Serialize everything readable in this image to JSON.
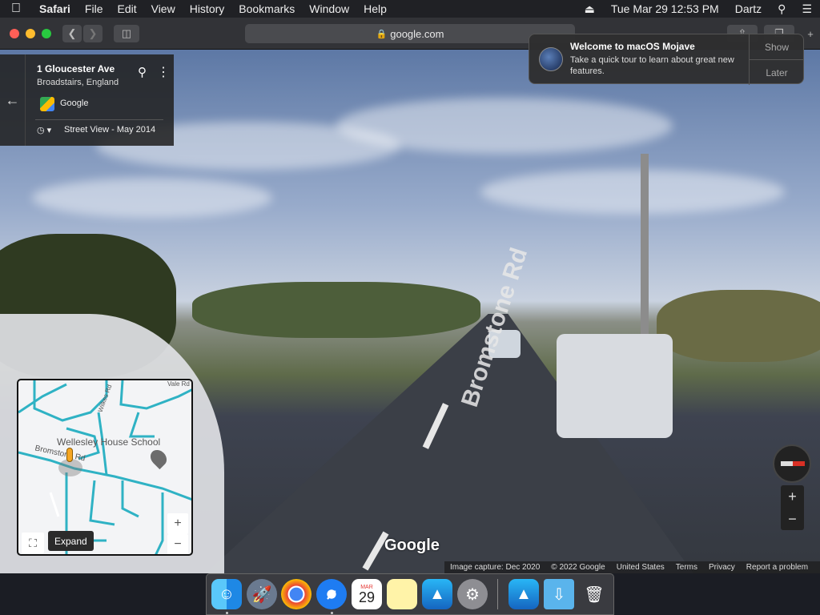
{
  "menubar": {
    "apple": "",
    "app": "Safari",
    "menus": [
      "File",
      "Edit",
      "View",
      "History",
      "Bookmarks",
      "Window",
      "Help"
    ],
    "datetime": "Tue Mar 29  12:53 PM",
    "user": "Dartz"
  },
  "toolbar": {
    "url": "google.com"
  },
  "infocard": {
    "title": "1 Gloucester Ave",
    "subtitle": "Broadstairs, England",
    "brand": "Google",
    "history": "Street View - May 2014"
  },
  "notification": {
    "title": "Welcome to macOS Mojave",
    "body": "Take a quick tour to learn about great new features.",
    "show_label": "Show",
    "later_label": "Later"
  },
  "road_label": "Bromstone Rd",
  "minimap": {
    "labels": {
      "school": "Wellesley House School",
      "road": "Bromstone Rd",
      "street": "Wilkes Rd",
      "vale": "Vale Rd"
    },
    "expand_tooltip": "Expand",
    "zoom_in": "+",
    "zoom_out": "−"
  },
  "zoom": {
    "in": "+",
    "out": "−"
  },
  "google_logo": "Google",
  "footer": {
    "capture": "Image capture: Dec 2020",
    "copyright": "© 2022 Google",
    "region": "United States",
    "terms": "Terms",
    "privacy": "Privacy",
    "report": "Report a problem"
  },
  "dock": {
    "calendar_month": "MAR",
    "calendar_day": "29"
  },
  "colors": {
    "map_road": "#2fb2c4",
    "pegman": "#f5a623",
    "compass_red": "#d93025"
  }
}
